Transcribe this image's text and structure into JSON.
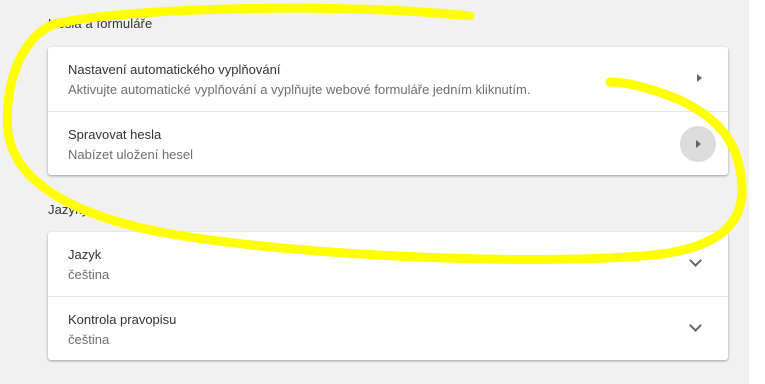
{
  "passwords_section": {
    "title": "Hesla a formuláře",
    "items": [
      {
        "title": "Nastavení automatického vyplňování",
        "subtitle": "Aktivujte automatické vyplňování a vyplňujte webové formuláře jedním kliknutím."
      },
      {
        "title": "Spravovat hesla",
        "subtitle": "Nabízet uložení hesel"
      }
    ]
  },
  "languages_section": {
    "title": "Jazyky",
    "items": [
      {
        "title": "Jazyk",
        "subtitle": "čeština"
      },
      {
        "title": "Kontrola pravopisu",
        "subtitle": "čeština"
      }
    ]
  },
  "colors": {
    "background": "#f1f1f1",
    "card": "#ffffff",
    "annotation": "#ffff00"
  },
  "icons": {
    "expand": "arrow-right-icon",
    "collapse": "chevron-down-icon"
  }
}
